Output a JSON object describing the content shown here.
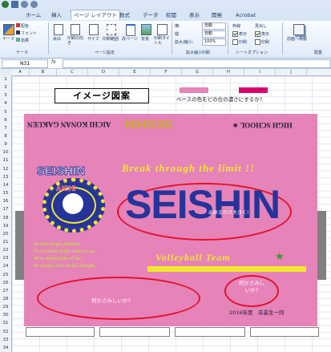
{
  "tabs": [
    "ホーム",
    "挿入",
    "ページ レイアウト",
    "数式",
    "データ",
    "校閲",
    "表示",
    "開発",
    "Acrobat"
  ],
  "active_tab": "ページ レイアウト",
  "ribbon": {
    "themes_group": {
      "label": "テーマ",
      "big": "テーマ",
      "items": [
        "配色",
        "フォント",
        "効果"
      ]
    },
    "page_setup": {
      "label": "ページ設定",
      "buttons": [
        "余白",
        "印刷の向き",
        "サイズ",
        "印刷範囲",
        "改ページ",
        "背景",
        "印刷タイトル"
      ]
    },
    "scale": {
      "label": "拡大縮小印刷",
      "rows": [
        {
          "name": "横:",
          "value": "自動"
        },
        {
          "name": "縦:",
          "value": "自動"
        },
        {
          "name": "拡大/縮小:",
          "value": "100%"
        }
      ]
    },
    "sheet_options": {
      "label": "シートオプション",
      "col1": "枠線",
      "col2": "見出し",
      "view": "表示",
      "print": "印刷"
    },
    "arrange": {
      "label": "配置",
      "front": "前面へ移動"
    }
  },
  "name_box": "N31",
  "fx_label": "fx",
  "columns": [
    "A",
    "B",
    "C",
    "D",
    "E",
    "F",
    "G",
    "H",
    "I",
    "J"
  ],
  "rows": [
    "1",
    "2",
    "3",
    "4",
    "5",
    "6",
    "7",
    "8",
    "9",
    "10",
    "11",
    "12",
    "13",
    "14",
    "15",
    "16",
    "17",
    "18",
    "19",
    "20",
    "21",
    "22",
    "23",
    "24",
    "25",
    "26",
    "27",
    "28",
    "29",
    "30",
    "31",
    "32",
    "33",
    "34"
  ],
  "image_title": "イメージ図案",
  "color_question": "ベースの色をどの位の濃さにするか?",
  "swatch_colors": [
    "#e683b8",
    "#d9006f"
  ],
  "upside_down": {
    "left": "AICHI KONAN GAKUEN",
    "center": "SEISHIN",
    "right": "HIGH SCHOOL ✶"
  },
  "emblem": {
    "top": "SEISHIN",
    "middle": "AICHI"
  },
  "slogan": "Break through the limit !!",
  "main_title": "SEISHIN",
  "big_note": "出来るだけ大きく!",
  "poem": [
    "We don't forget gratitude",
    "To everybody being related to us.",
    "We've defeated the all foe.",
    "We always write the full strength."
  ],
  "team": "Volleyball Team",
  "star": "★",
  "notes": [
    "何かさみしいか?",
    "何かさみしいか?"
  ],
  "footer": "2016年度　卒業生一同",
  "colors": {
    "pink": "#e683b8",
    "magenta": "#d9006f",
    "blue": "#25349b",
    "yellow": "#f1e62e",
    "red": "#e4112a",
    "lime": "#bdf227"
  }
}
